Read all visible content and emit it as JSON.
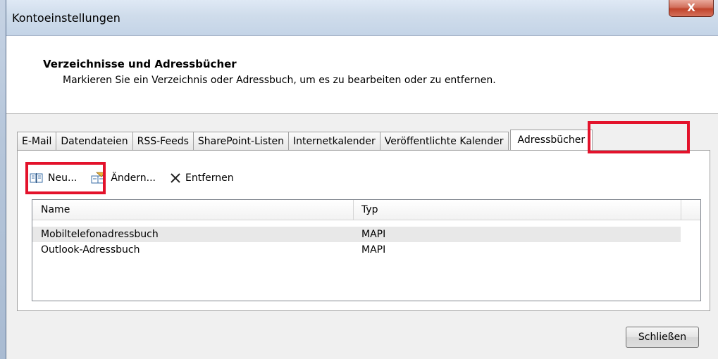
{
  "window": {
    "title": "Kontoeinstellungen",
    "close_glyph": "X"
  },
  "header": {
    "title": "Verzeichnisse und Adressbücher",
    "subtitle": "Markieren Sie ein Verzeichnis oder Adressbuch, um es zu bearbeiten oder zu entfernen."
  },
  "tabs": [
    {
      "label": "E-Mail"
    },
    {
      "label": "Datendateien"
    },
    {
      "label": "RSS-Feeds"
    },
    {
      "label": "SharePoint-Listen"
    },
    {
      "label": "Internetkalender"
    },
    {
      "label": "Veröffentlichte Kalender"
    },
    {
      "label": "Adressbücher",
      "active": true
    }
  ],
  "toolbar": {
    "new_label": "Neu...",
    "new_icon": "address-book-icon",
    "change_label": "Ändern...",
    "change_icon": "change-book-icon",
    "remove_label": "Entfernen",
    "remove_icon": "x-icon"
  },
  "list": {
    "columns": [
      "Name",
      "Typ"
    ],
    "rows": [
      {
        "name": "Mobiltelefonadressbuch",
        "type": "MAPI",
        "selected": true
      },
      {
        "name": "Outlook-Adressbuch",
        "type": "MAPI",
        "selected": false
      }
    ]
  },
  "footer": {
    "close_label": "Schließen"
  },
  "colors": {
    "highlight": "#e3122b",
    "close_button": "#c0442c"
  }
}
